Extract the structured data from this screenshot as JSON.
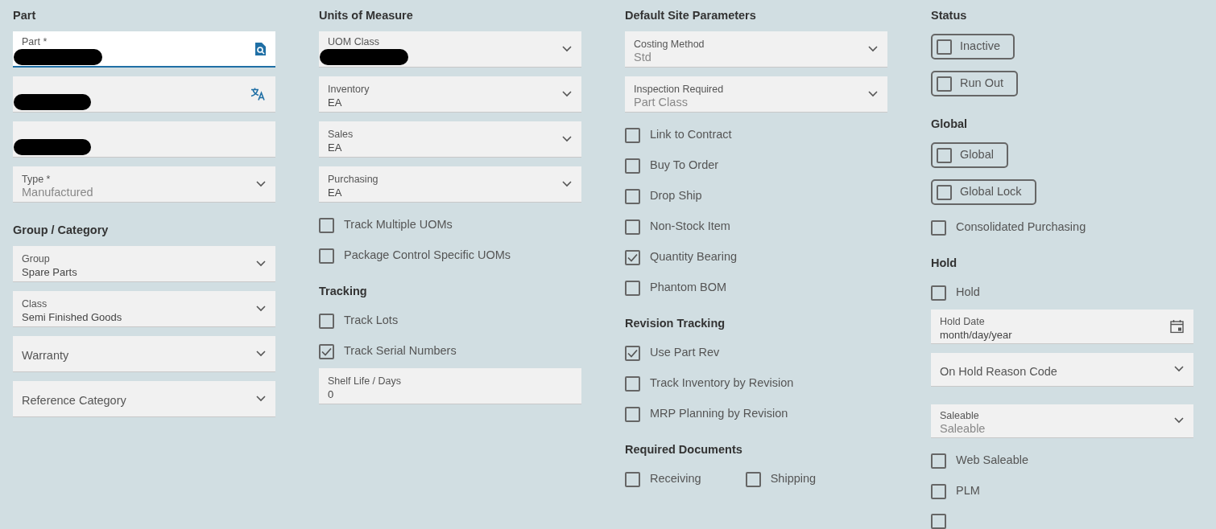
{
  "columns": [
    {
      "items": [
        {
          "kind": "heading",
          "text": "Part"
        },
        {
          "kind": "lookup",
          "label": "Part *",
          "focused": true,
          "redacted": true
        },
        {
          "kind": "translatable",
          "redacted": true
        },
        {
          "kind": "text",
          "redacted": true
        },
        {
          "kind": "select",
          "label": "Type *",
          "value": "Manufactured",
          "disabled": true
        },
        {
          "kind": "heading",
          "text": "Group / Category"
        },
        {
          "kind": "select",
          "label": "Group",
          "value": "Spare Parts",
          "disabled": false
        },
        {
          "kind": "select",
          "label": "Class",
          "value": "Semi Finished Goods",
          "disabled": false
        },
        {
          "kind": "select",
          "placeholder": "Warranty"
        },
        {
          "kind": "select",
          "placeholder": "Reference Category"
        }
      ]
    },
    {
      "items": [
        {
          "kind": "heading",
          "text": "Units of Measure"
        },
        {
          "kind": "select",
          "label": "UOM Class",
          "redacted": true
        },
        {
          "kind": "select",
          "label": "Inventory",
          "value": "EA",
          "disabled": false
        },
        {
          "kind": "select",
          "label": "Sales",
          "value": "EA",
          "disabled": false
        },
        {
          "kind": "select",
          "label": "Purchasing",
          "value": "EA",
          "disabled": false
        },
        {
          "kind": "checkbox",
          "label": "Track Multiple UOMs",
          "checked": false
        },
        {
          "kind": "checkbox",
          "label": "Package Control Specific UOMs",
          "checked": false
        },
        {
          "kind": "heading",
          "text": "Tracking"
        },
        {
          "kind": "checkbox",
          "label": "Track Lots",
          "checked": false
        },
        {
          "kind": "checkbox",
          "label": "Track Serial Numbers",
          "checked": true
        },
        {
          "kind": "text",
          "label": "Shelf Life / Days",
          "value": "0",
          "focused": false
        }
      ]
    },
    {
      "items": [
        {
          "kind": "heading",
          "text": "Default Site Parameters"
        },
        {
          "kind": "select",
          "label": "Costing Method",
          "value": "Std",
          "disabled": true
        },
        {
          "kind": "select",
          "label": "Inspection Required",
          "value": "Part Class",
          "disabled": true
        },
        {
          "kind": "checkbox",
          "label": "Link to Contract",
          "checked": false
        },
        {
          "kind": "checkbox",
          "label": "Buy To Order",
          "checked": false
        },
        {
          "kind": "checkbox",
          "label": "Drop Ship",
          "checked": false
        },
        {
          "kind": "checkbox",
          "label": "Non-Stock Item",
          "checked": false
        },
        {
          "kind": "checkbox",
          "label": "Quantity Bearing",
          "checked": true
        },
        {
          "kind": "checkbox",
          "label": "Phantom BOM",
          "checked": false
        },
        {
          "kind": "heading",
          "text": "Revision Tracking"
        },
        {
          "kind": "checkbox",
          "label": "Use Part Rev",
          "checked": true
        },
        {
          "kind": "checkbox",
          "label": "Track Inventory by Revision",
          "checked": false
        },
        {
          "kind": "checkbox",
          "label": "MRP Planning by Revision",
          "checked": false
        },
        {
          "kind": "heading",
          "text": "Required Documents"
        },
        {
          "kind": "checkrow",
          "boxes": [
            {
              "label": "Receiving",
              "checked": false
            },
            {
              "label": "Shipping",
              "checked": false
            }
          ]
        }
      ]
    },
    {
      "items": [
        {
          "kind": "heading",
          "text": "Status"
        },
        {
          "kind": "toggle",
          "label": "Inactive",
          "checked": false
        },
        {
          "kind": "toggle",
          "label": "Run Out",
          "checked": false
        },
        {
          "kind": "heading",
          "text": "Global"
        },
        {
          "kind": "toggle",
          "label": "Global",
          "checked": false
        },
        {
          "kind": "toggle",
          "label": "Global Lock",
          "checked": false
        },
        {
          "kind": "checkbox",
          "label": "Consolidated Purchasing",
          "checked": false
        },
        {
          "kind": "heading",
          "text": "Hold"
        },
        {
          "kind": "checkbox",
          "label": "Hold",
          "checked": false
        },
        {
          "kind": "date",
          "label": "Hold Date",
          "value": "month/day/year"
        },
        {
          "kind": "select",
          "placeholder": "On Hold Reason Code"
        },
        {
          "kind": "gap"
        },
        {
          "kind": "select",
          "label": "Saleable",
          "value": "Saleable",
          "disabled": true
        },
        {
          "kind": "checkbox",
          "label": "Web Saleable",
          "checked": false
        },
        {
          "kind": "checkbox",
          "label": "PLM",
          "checked": false
        },
        {
          "kind": "checkbox",
          "checked": false
        }
      ]
    }
  ]
}
